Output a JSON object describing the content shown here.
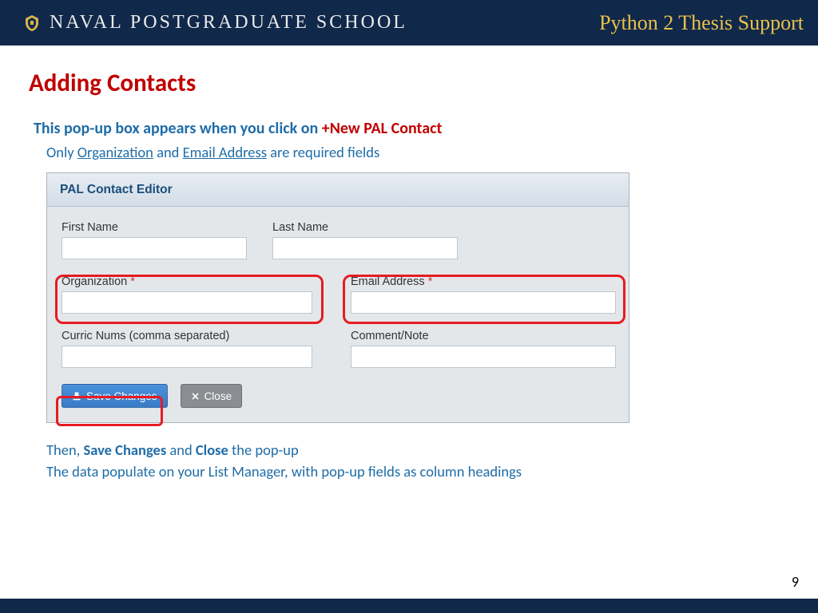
{
  "header": {
    "institution": "NAVAL POSTGRADUATE SCHOOL",
    "course": "Python 2 Thesis Support"
  },
  "page": {
    "title": "Adding Contacts",
    "number": "9"
  },
  "instructions": {
    "line1_prefix": "This pop-up box appears when you click on ",
    "line1_action": "+New PAL Contact",
    "line2_prefix": "Only ",
    "line2_field1": "Organization",
    "line2_mid": " and ",
    "line2_field2": "Email Address",
    "line2_suffix": " are required fields",
    "note1_pre": "Then, ",
    "note1_b1": "Save Changes",
    "note1_mid": " and ",
    "note1_b2": "Close",
    "note1_post": " the pop-up",
    "note2": "The data populate on your List Manager, with pop-up fields as column headings"
  },
  "editor": {
    "title": "PAL Contact Editor",
    "fields": {
      "first_name": {
        "label": "First Name",
        "value": ""
      },
      "last_name": {
        "label": "Last Name",
        "value": ""
      },
      "organization": {
        "label": "Organization ",
        "req": "*",
        "value": ""
      },
      "email": {
        "label": "Email Address ",
        "req": "*",
        "value": ""
      },
      "curric": {
        "label": "Curric Nums (comma separated)",
        "value": ""
      },
      "comment": {
        "label": "Comment/Note",
        "value": ""
      }
    },
    "buttons": {
      "save": "Save Changes",
      "close": "Close"
    }
  }
}
